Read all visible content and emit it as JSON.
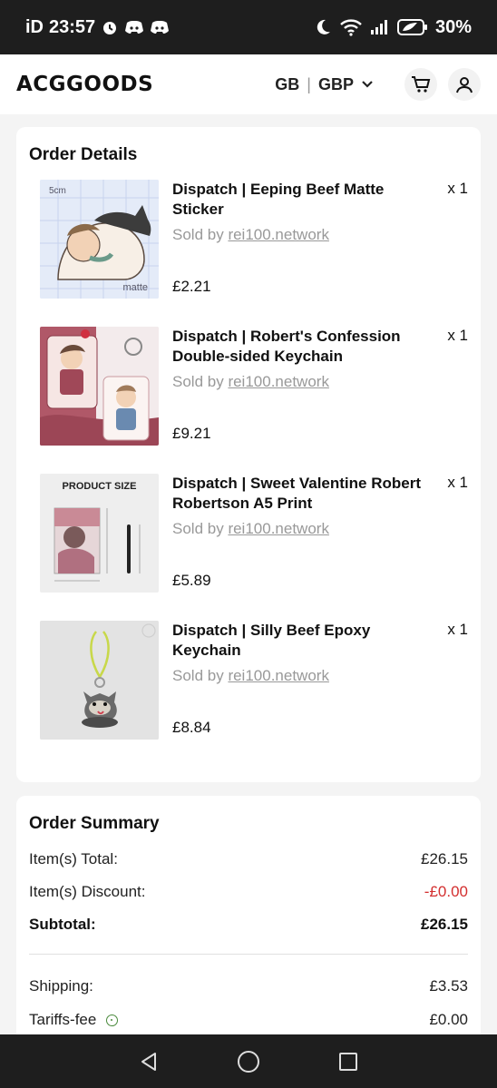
{
  "status_bar": {
    "carrier": "iD",
    "time": "23:57",
    "battery": "30%"
  },
  "header": {
    "logo": "ACGGOODS",
    "country": "GB",
    "currency": "GBP"
  },
  "order_details": {
    "title": "Order Details",
    "sold_by_prefix": "Sold by",
    "items": [
      {
        "name": "Dispatch | Eeping Beef Matte Sticker",
        "qty": "x 1",
        "seller": "rei100.network",
        "price": "£2.21"
      },
      {
        "name": "Dispatch | Robert's Confession Double-sided Keychain",
        "qty": "x 1",
        "seller": "rei100.network",
        "price": "£9.21"
      },
      {
        "name": "Dispatch | Sweet Valentine Robert Robertson A5 Print",
        "qty": "x 1",
        "seller": "rei100.network",
        "price": "£5.89",
        "thumb_label": "PRODUCT SIZE"
      },
      {
        "name": "Dispatch | Silly Beef Epoxy Keychain",
        "qty": "x 1",
        "seller": "rei100.network",
        "price": "£8.84"
      }
    ],
    "thumb_text": {
      "sticker_size": "5cm",
      "sticker_finish": "matte"
    }
  },
  "order_summary": {
    "title": "Order Summary",
    "items_total_label": "Item(s) Total:",
    "items_total_value": "£26.15",
    "discount_label": "Item(s) Discount:",
    "discount_value": "-£0.00",
    "subtotal_label": "Subtotal:",
    "subtotal_value": "£26.15",
    "shipping_label": "Shipping:",
    "shipping_value": "£3.53",
    "tariffs_label": "Tariffs-fee",
    "tariffs_value": "£0.00"
  },
  "colors": {
    "status_bar_bg": "#1e1e1e",
    "discount_red": "#d32f2f",
    "muted_text": "#999999"
  }
}
